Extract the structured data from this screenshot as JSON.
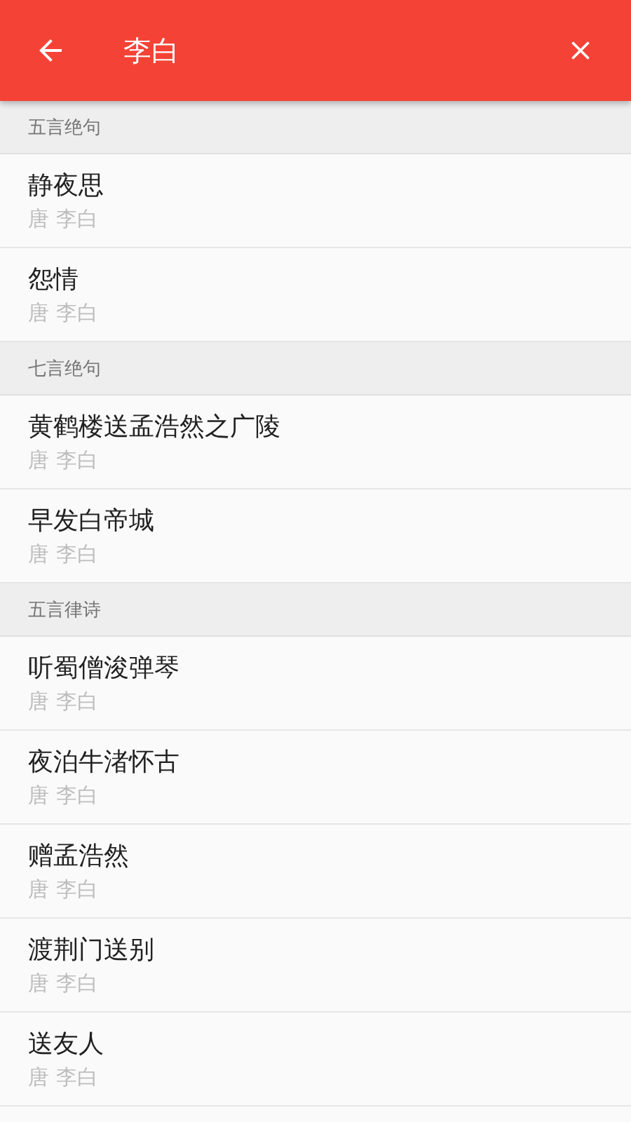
{
  "header": {
    "title": "李白"
  },
  "sections": [
    {
      "title": "五言绝句",
      "items": [
        {
          "title": "静夜思",
          "subtitle": "唐 李白"
        },
        {
          "title": "怨情",
          "subtitle": "唐 李白"
        }
      ]
    },
    {
      "title": "七言绝句",
      "items": [
        {
          "title": "黄鹤楼送孟浩然之广陵",
          "subtitle": "唐 李白"
        },
        {
          "title": "早发白帝城",
          "subtitle": "唐 李白"
        }
      ]
    },
    {
      "title": "五言律诗",
      "items": [
        {
          "title": "听蜀僧浚弹琴",
          "subtitle": "唐 李白"
        },
        {
          "title": "夜泊牛渚怀古",
          "subtitle": "唐 李白"
        },
        {
          "title": "赠孟浩然",
          "subtitle": "唐 李白"
        },
        {
          "title": "渡荆门送别",
          "subtitle": "唐 李白"
        },
        {
          "title": "送友人",
          "subtitle": "唐 李白"
        }
      ]
    }
  ]
}
